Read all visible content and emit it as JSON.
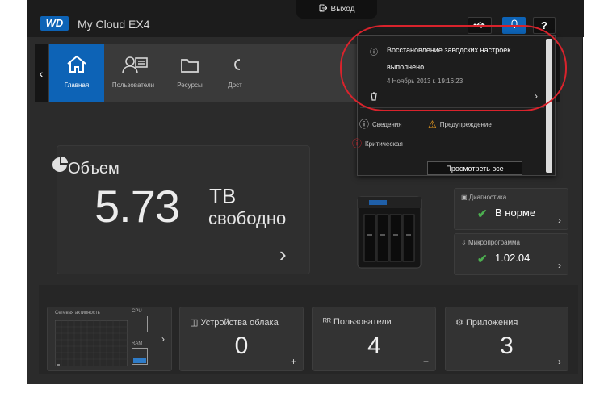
{
  "app": {
    "logo_text": "WD",
    "title": "My Cloud EX4",
    "logout_label": "Выход",
    "help_label": "?",
    "colors": {
      "accent": "#0d63b6",
      "ok": "#4caf50",
      "alert": "#d9232c",
      "warn": "#f0a020"
    }
  },
  "nav": {
    "prev_label": "‹",
    "next_label": "›",
    "items": [
      {
        "label": "Главная",
        "icon": "home-icon",
        "active": true
      },
      {
        "label": "Пользователи",
        "icon": "users-icon",
        "active": false
      },
      {
        "label": "Ресурсы",
        "icon": "folder-icon",
        "active": false
      },
      {
        "label": "Дост",
        "icon": "cloud-access-icon",
        "active": false
      }
    ]
  },
  "storage": {
    "title": "Объем",
    "value": "5.73",
    "unit": "ТВ",
    "free_label": "свободно",
    "arrow": "›"
  },
  "status": {
    "diagnostics": {
      "label": "Диагностика",
      "value": "В норме"
    },
    "firmware": {
      "label": "Микропрограмма",
      "value": "1.02.04"
    }
  },
  "network": {
    "label": "Сетевая активность",
    "cpu_label": "CPU",
    "ram_label": "RAM"
  },
  "tiles": [
    {
      "label": "Устройства облака",
      "value": "0",
      "action": "+"
    },
    {
      "label": "Пользователи",
      "value": "4",
      "action": "+"
    },
    {
      "label": "Приложения",
      "value": "3",
      "action": "›"
    }
  ],
  "notification": {
    "message_line1": "Восстановление заводских настроек",
    "message_line2": "выполнено",
    "date": "4 Ноябрь 2013 г. 19:16:23",
    "filters": {
      "info": "Сведения",
      "warning": "Предупреждение",
      "critical": "Критическая"
    },
    "view_all_label": "Просмотреть все"
  }
}
